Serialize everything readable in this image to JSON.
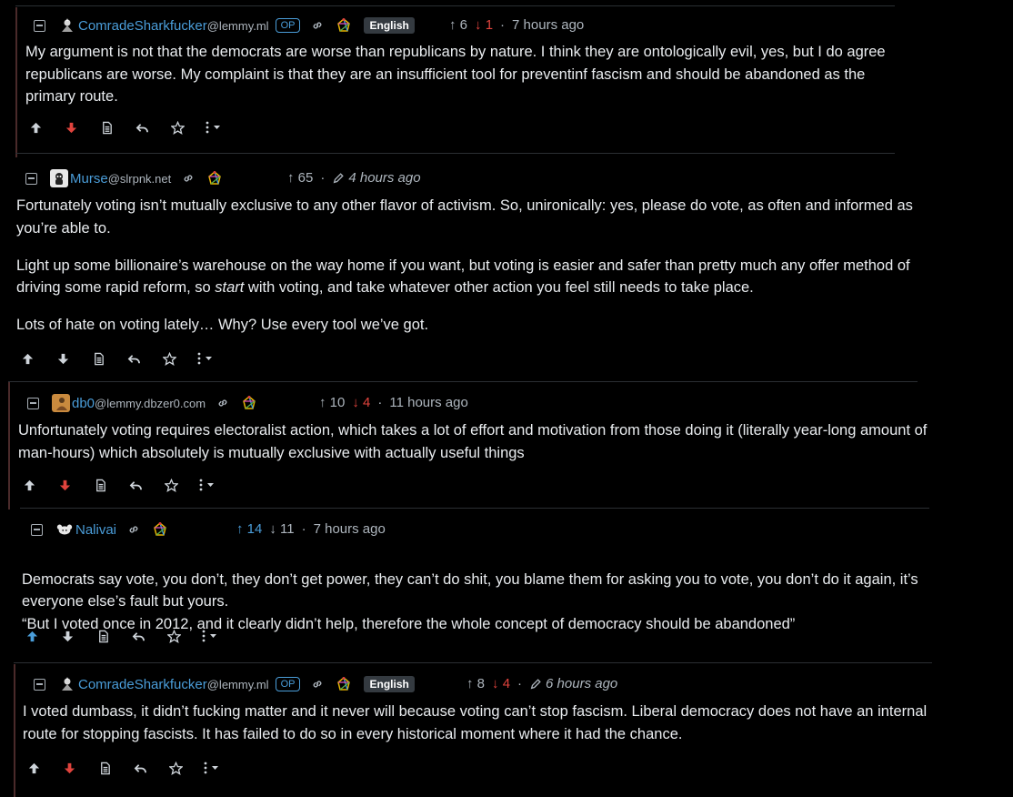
{
  "comments": [
    {
      "user": "ComradeSharkfucker",
      "instance": "@lemmy.ml",
      "op": "OP",
      "language": "English",
      "upvotes": "6",
      "downvotes": "1",
      "time": "7 hours ago",
      "edited": false,
      "voted": "down",
      "paragraphs": [
        "My argument is not that the democrats are worse than republicans by nature. I think they are ontologically evil, yes, but I do agree republicans are worse. My complaint is that they are an insufficient tool for preventinf fascism and should be abandoned as the primary route."
      ]
    },
    {
      "user": "Murse",
      "instance": "@slrpnk.net",
      "upvotes": "65",
      "time": "4 hours ago",
      "edited": true,
      "voted": "none",
      "paragraphs": [
        "Fortunately voting isn’t mutually exclusive to any other flavor of activism. So, unironically: yes, please do vote, as often and informed as you’re able to.",
        "Light up some billionaire’s warehouse on the way home if you want, but voting is easier and safer than pretty much any offer method of driving some rapid reform, so start with voting, and take whatever other action you feel still needs to take place.",
        "Lots of hate on voting lately… Why? Use every tool we’ve got."
      ]
    },
    {
      "user": "db0",
      "instance": "@lemmy.dbzer0.com",
      "upvotes": "10",
      "downvotes": "4",
      "time": "11 hours ago",
      "edited": false,
      "voted": "down",
      "paragraphs": [
        "Unfortunately voting requires electoralist action, which takes a lot of effort and motivation from those doing it (literally year-long amount of man-hours) which absolutely is mutually exclusive with actually useful things"
      ]
    },
    {
      "user": "Nalivai",
      "instance": "",
      "upvotes": "14",
      "downvotes": "11",
      "time": "7 hours ago",
      "edited": false,
      "voted": "up",
      "paragraphs": [
        "Democrats say vote, you don’t, they don’t get power, they can’t do shit, you blame them for asking you to vote, you don’t do it again, it’s everyone else’s fault but yours.\n“But I voted once in 2012, and it clearly didn’t help, therefore the whole concept of democracy should be abandoned”"
      ]
    },
    {
      "user": "ComradeSharkfucker",
      "instance": "@lemmy.ml",
      "op": "OP",
      "language": "English",
      "upvotes": "8",
      "downvotes": "4",
      "time": "6 hours ago",
      "edited": true,
      "voted": "down",
      "paragraphs": [
        "I voted dumbass, it didn’t fucking matter and it never will because voting can’t stop fascism. Liberal democracy does not have an internal route for stopping fascists. It has failed to do so in every historical moment where it had the chance."
      ]
    }
  ],
  "icons": {
    "collapse": "collapse-icon",
    "link": "link-icon",
    "federation": "fediverse-icon",
    "upvote": "arrow-up-icon",
    "downvote": "arrow-down-icon",
    "source": "document-icon",
    "reply": "reply-icon",
    "save": "star-icon",
    "more": "more-icon"
  },
  "colors": {
    "link": "#4a9dd9",
    "downvote": "#e0433d",
    "background": "#000000"
  }
}
